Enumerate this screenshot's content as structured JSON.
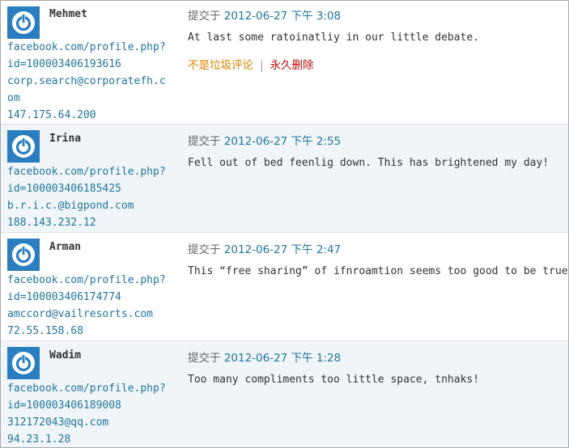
{
  "comments": [
    {
      "author": "Mehmet",
      "profile_line1": "facebook.com/profile.php?",
      "profile_line2": "id=100003406193616",
      "email_line1": "corp.search@corporatefh.c",
      "email_line2": "om",
      "ip": "147.175.64.200",
      "submitted_label": "提交于",
      "datetime": "2012-06-27 下午 3:08",
      "text": "At last some ratoinatliy in our little debate.",
      "action_not_spam": "不是垃圾评论",
      "action_separator": "|",
      "action_delete": "永久删除"
    },
    {
      "author": "Irina",
      "profile_line1": "facebook.com/profile.php?",
      "profile_line2": "id=100003406185425",
      "email": "b.r.i.c.@bigpond.com",
      "ip": "188.143.232.12",
      "submitted_label": "提交于",
      "datetime": "2012-06-27 下午 2:55",
      "text": "Fell out of bed feenlig down. This has brightened my day!"
    },
    {
      "author": "Arman",
      "profile_line1": "facebook.com/profile.php?",
      "profile_line2": "id=100003406174774",
      "email": "amccord@vailresorts.com",
      "ip": "72.55.158.68",
      "submitted_label": "提交于",
      "datetime": "2012-06-27 下午 2:47",
      "text": "This “free sharing” of ifnroamtion seems too good to be true"
    },
    {
      "author": "Wadim",
      "profile_line1": "facebook.com/profile.php?",
      "profile_line2": "id=100003406189008",
      "email": "312172043@qq.com",
      "ip": "94.23.1.28",
      "submitted_label": "提交于",
      "datetime": "2012-06-27 下午 1:28",
      "text": "Too many compliments too little space, tnhaks!"
    }
  ],
  "colors": {
    "link": "#21759b",
    "alt_row": "#f0f5f9",
    "not_spam": "#d98500",
    "delete": "#bc0b0b",
    "avatar": "#2a7ec0"
  },
  "icons": {
    "avatar": "power-symbol-avatar-icon"
  }
}
